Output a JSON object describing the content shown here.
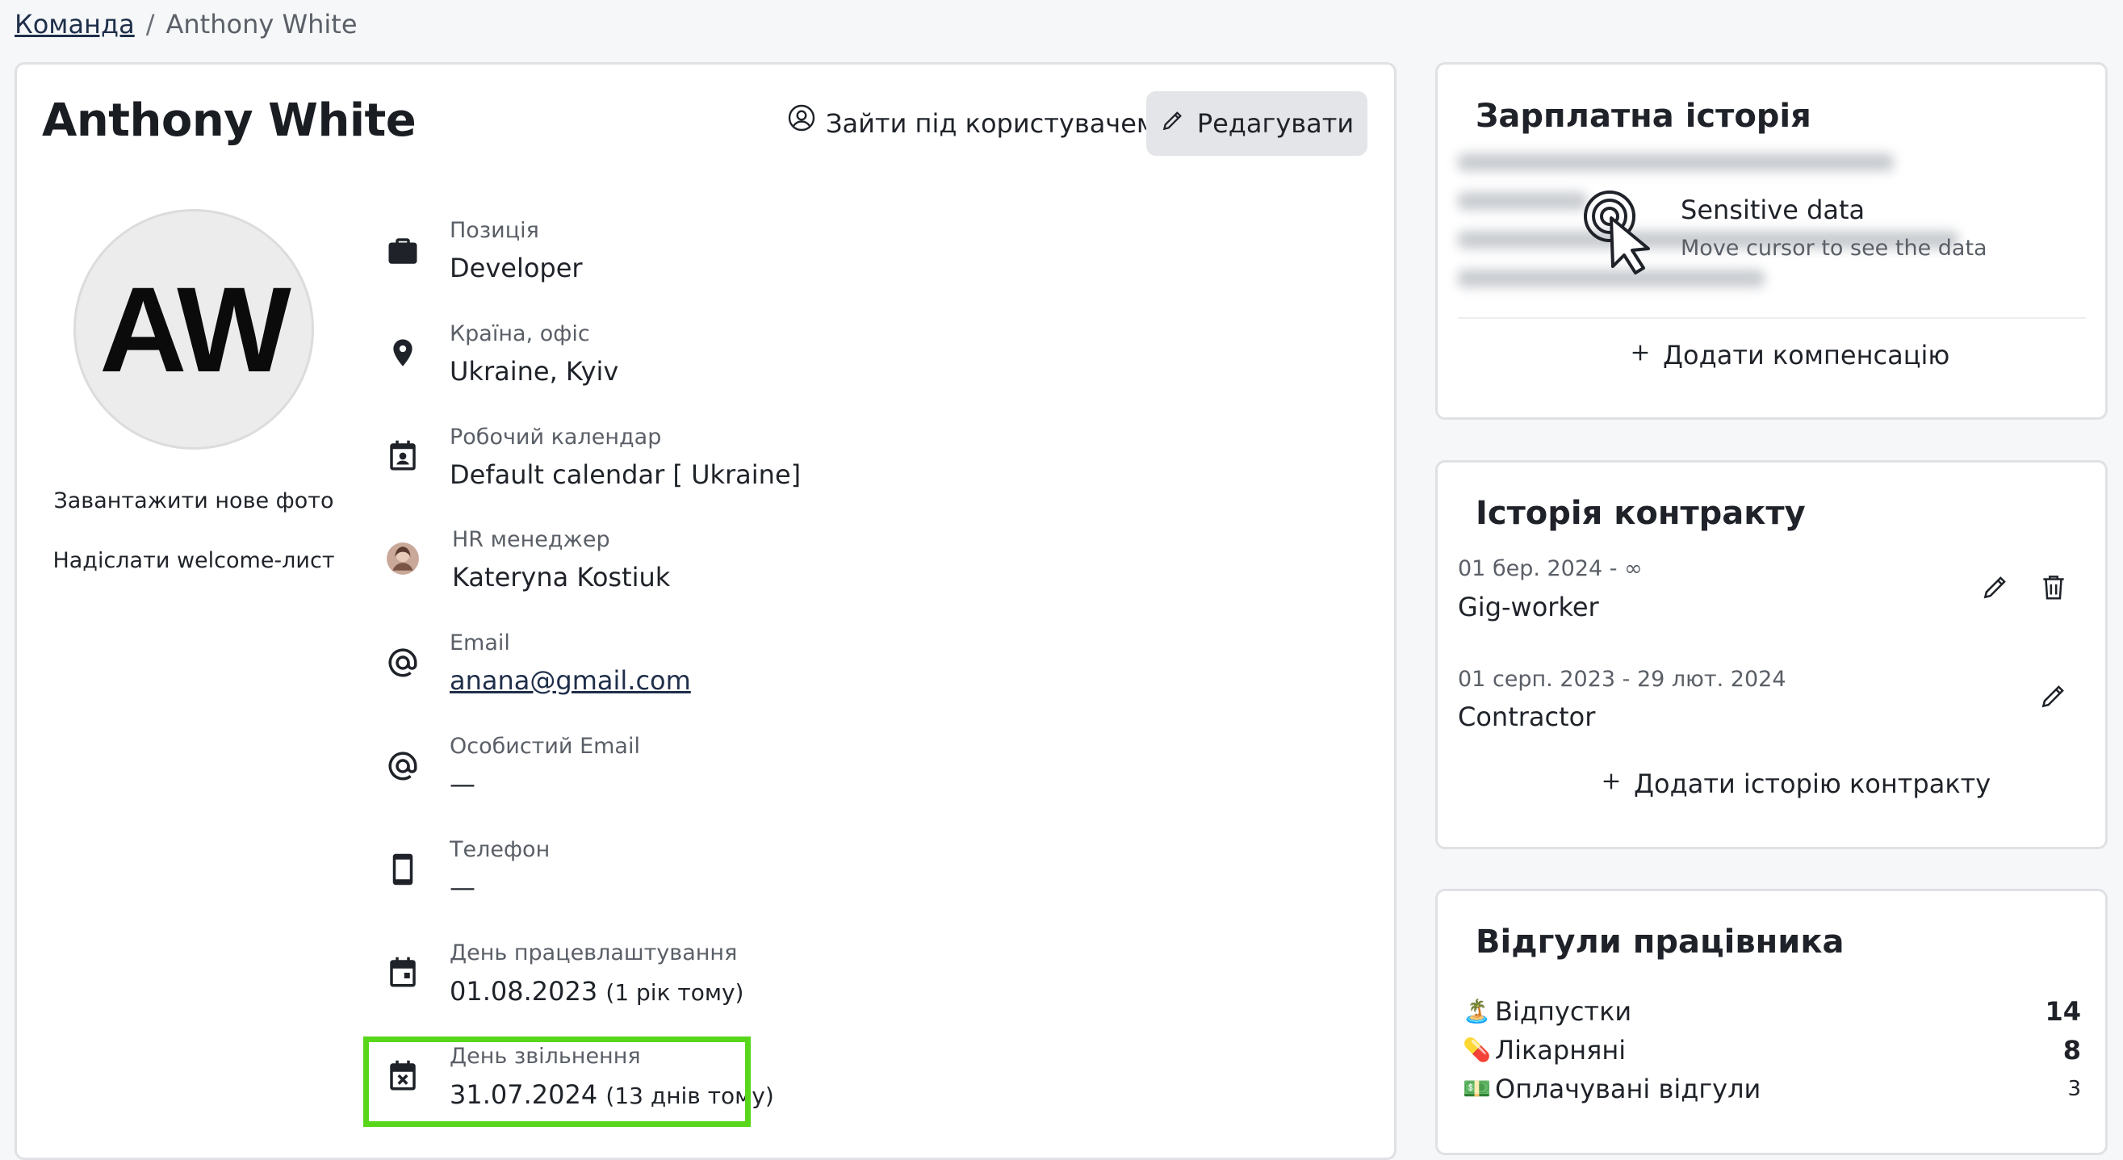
{
  "breadcrumb": {
    "parent": "Команда",
    "separator": "/",
    "current": "Anthony White"
  },
  "profile": {
    "name": "Anthony White",
    "login_as_label": "Зайти під користувачем",
    "edit_label": "Редагувати",
    "initials": "AW",
    "upload_photo_label": "Завантажити нове фото",
    "send_welcome_label": "Надіслати welcome-лист"
  },
  "fields": {
    "position": {
      "label": "Позиція",
      "value": "Developer",
      "icon": "briefcase-icon"
    },
    "location": {
      "label": "Країна, офіс",
      "value": "Ukraine, Kyiv",
      "icon": "location-pin-icon"
    },
    "calendar": {
      "label": "Робочий календар",
      "value": "Default calendar [ Ukraine]",
      "icon": "contact-calendar-icon"
    },
    "hr": {
      "label": "HR менеджер",
      "value": "Kateryna Kostiuk",
      "icon": "hr-avatar"
    },
    "email": {
      "label": "Email",
      "value": "anana@gmail.com",
      "icon": "at-sign-icon"
    },
    "personal_email": {
      "label": "Особистий Email",
      "value": "—",
      "icon": "at-sign-icon"
    },
    "phone": {
      "label": "Телефон",
      "value": "—",
      "icon": "phone-icon"
    },
    "hire_date": {
      "label": "День працевлаштування",
      "value": "01.08.2023",
      "note": "(1 рік тому)",
      "icon": "calendar-event-icon"
    },
    "dismissal_date": {
      "label": "День звільнення",
      "value": "31.07.2024",
      "note": "(13 днів тому)",
      "icon": "calendar-x-icon"
    }
  },
  "salary": {
    "title": "Зарплатна історія",
    "sensitive_title": "Sensitive data",
    "sensitive_subtitle": "Move cursor to see the data",
    "add_label": "Додати компенсацію"
  },
  "contracts": {
    "title": "Історія контракту",
    "items": [
      {
        "dates": "01 бер. 2024 - ∞",
        "type": "Gig-worker"
      },
      {
        "dates": "01 серп. 2023 - 29 лют. 2024",
        "type": "Contractor"
      }
    ],
    "add_label": "Додати історію контракту"
  },
  "leaves": {
    "title": "Відгули працівника",
    "items": [
      {
        "emoji": "🏝️",
        "label": "Відпустки",
        "count": "14"
      },
      {
        "emoji": "💊",
        "label": "Лікарняні",
        "count": "8"
      },
      {
        "emoji": "💵",
        "label": "Оплачувані відгули",
        "count": "3"
      }
    ]
  },
  "colors": {
    "highlight": "#58d61a",
    "card_border": "#dfe1e5",
    "button_bg": "#e4e5e8",
    "link": "#1f2f4a"
  }
}
